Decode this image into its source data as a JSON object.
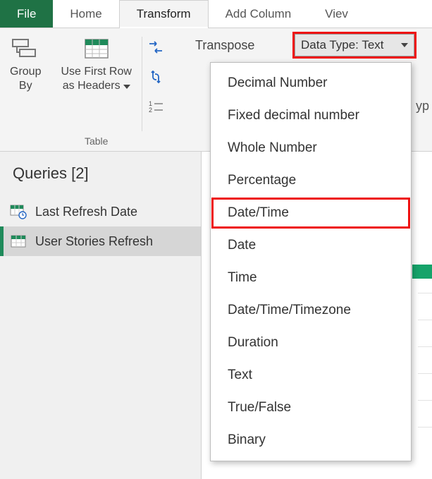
{
  "tabs": {
    "file": "File",
    "home": "Home",
    "transform": "Transform",
    "add_column": "Add Column",
    "view": "Viev"
  },
  "ribbon": {
    "group_by": {
      "line1": "Group",
      "line2": "By"
    },
    "use_first_row": {
      "line1": "Use First Row",
      "line2": "as Headers"
    },
    "group_caption_table": "Table",
    "transpose_label": "Transpose",
    "datatype_button": "Data Type: Text",
    "truncated_right": "yp"
  },
  "queries": {
    "header": "Queries [2]",
    "items": [
      {
        "label": "Last Refresh Date",
        "selected": false
      },
      {
        "label": "User Stories Refresh",
        "selected": true
      }
    ]
  },
  "datatype_menu": {
    "items": [
      "Decimal Number",
      "Fixed decimal number",
      "Whole Number",
      "Percentage",
      "Date/Time",
      "Date",
      "Time",
      "Date/Time/Timezone",
      "Duration",
      "Text",
      "True/False",
      "Binary"
    ],
    "highlighted_index": 4
  }
}
